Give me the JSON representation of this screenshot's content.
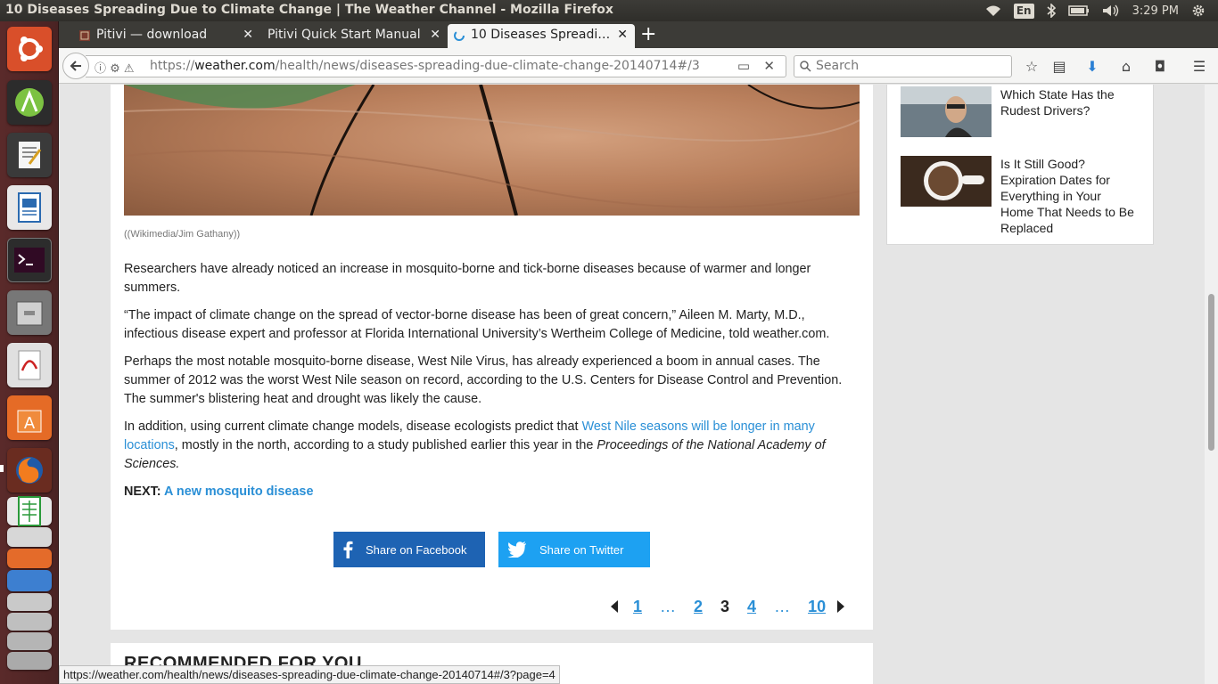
{
  "window": {
    "title": "10 Diseases Spreading Due to Climate Change | The Weather Channel - Mozilla Firefox",
    "clock": "3:29 PM",
    "keyboard_lang": "En"
  },
  "tabs": [
    {
      "label": "Pitivi — download",
      "icon": "pitivi-icon"
    },
    {
      "label": "Pitivi Quick Start Manual",
      "icon": "none"
    },
    {
      "label": "10 Diseases Spreadi…",
      "icon": "loading-icon",
      "active": true
    }
  ],
  "navbar": {
    "url_prefix": "https://",
    "url_domain": "weather.com",
    "url_path": "/health/news/diseases-spreading-due-climate-change-20140714#/3",
    "search_placeholder": "Search"
  },
  "article": {
    "caption": "((Wikimedia/Jim Gathany))",
    "p1": "Researchers have already noticed an increase in mosquito-borne and tick-borne diseases because of warmer and longer summers.",
    "p2": "“The impact of climate change on the spread of vector-borne disease has been of great concern,” Aileen M. Marty, M.D., infectious disease expert and professor at Florida International University’s Wertheim College of Medicine, told weather.com.",
    "p3": "Perhaps the most notable mosquito-borne disease, West Nile Virus, has already experienced a boom in annual cases. The summer of 2012 was the worst West Nile season on record, according to the U.S. Centers for Disease Control and Prevention. The summer's blistering heat and drought was likely the cause.",
    "p4_before": "In addition, using current climate change models, disease ecologists predict that ",
    "p4_link": "West Nile seasons will be longer in many locations",
    "p4_after": ", mostly in the north, according to a study published earlier this year in the ",
    "p4_italic": "Proceedings of the National Academy of Sciences.",
    "next_label": "NEXT:",
    "next_link": "A new mosquito disease",
    "share_facebook": "Share on Facebook",
    "share_twitter": "Share on Twitter"
  },
  "pagination": {
    "pages": [
      "1",
      "…",
      "2",
      "3",
      "4",
      "…",
      "10"
    ],
    "current": "3"
  },
  "recommended": {
    "title": "RECOMMENDED FOR YOU"
  },
  "sidebar": {
    "items": [
      {
        "text": "Which State Has the Rudest Drivers?"
      },
      {
        "text": "Is It Still Good? Expiration Dates for Everything in Your Home That Needs to Be Replaced"
      }
    ]
  },
  "statusbar": {
    "text": "https://weather.com/health/news/diseases-spreading-due-climate-change-20140714#/3?page=4"
  },
  "colors": {
    "link": "#2a8fd6",
    "facebook": "#1e63b3",
    "twitter": "#1da1f2",
    "launcher": "#5a2a2a"
  }
}
